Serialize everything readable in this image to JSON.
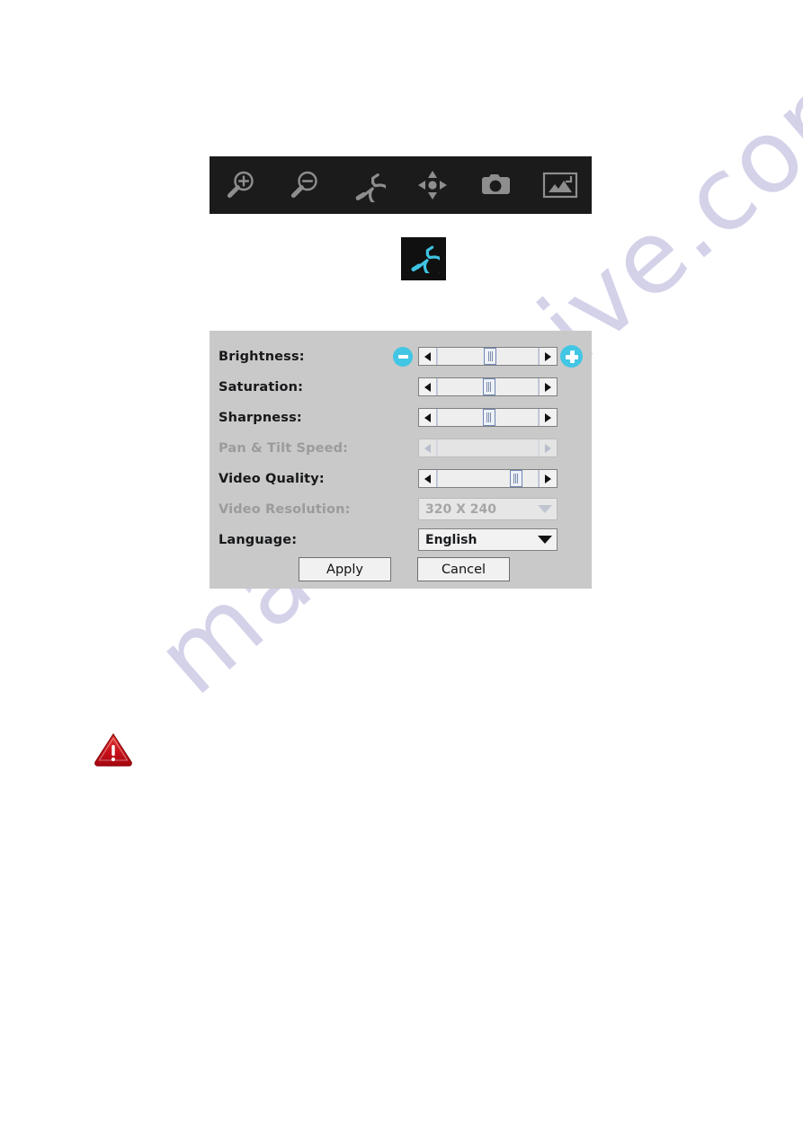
{
  "watermark": {
    "text": "manualshive.com"
  },
  "toolbar": {
    "name": "camera-viewer-toolbar",
    "buttons": [
      {
        "icon": "zoom-in-icon",
        "label": "Zoom In"
      },
      {
        "icon": "zoom-out-icon",
        "label": "Zoom Out"
      },
      {
        "icon": "wrench-icon",
        "label": "Settings"
      },
      {
        "icon": "pan-tilt-icon",
        "label": "Pan & Tilt"
      },
      {
        "icon": "camera-icon",
        "label": "Snapshot"
      },
      {
        "icon": "fullscreen-icon",
        "label": "Full Screen"
      }
    ]
  },
  "highlighted_icon": {
    "icon": "wrench-icon",
    "label": "Settings",
    "color": "#3fc3e2"
  },
  "dialog": {
    "name": "camera-settings-dialog",
    "background": "#c9c9c9",
    "rows": [
      {
        "label": "Brightness:",
        "control": "slider",
        "enabled": true,
        "thumb_percent": 48
      },
      {
        "label": "Saturation:",
        "control": "slider",
        "enabled": true,
        "thumb_percent": 47
      },
      {
        "label": "Sharpness:",
        "control": "slider",
        "enabled": true,
        "thumb_percent": 47
      },
      {
        "label": "Pan & Tilt Speed:",
        "control": "slider",
        "enabled": false,
        "thumb_percent": 0
      },
      {
        "label": "Video Quality:",
        "control": "slider",
        "enabled": true,
        "thumb_percent": 72
      },
      {
        "label": "Video Resolution:",
        "control": "dropdown",
        "enabled": false,
        "value": "320 X 240"
      },
      {
        "label": "Language:",
        "control": "dropdown",
        "enabled": true,
        "value": "English"
      }
    ],
    "stepper": {
      "minus_icon": "minus-circle-icon",
      "plus_icon": "plus-circle-icon",
      "color": "#41c6e4"
    },
    "buttons": {
      "apply": "Apply",
      "cancel": "Cancel"
    }
  },
  "notice": {
    "icon": "warning-triangle-icon",
    "color": "#cc1111"
  }
}
